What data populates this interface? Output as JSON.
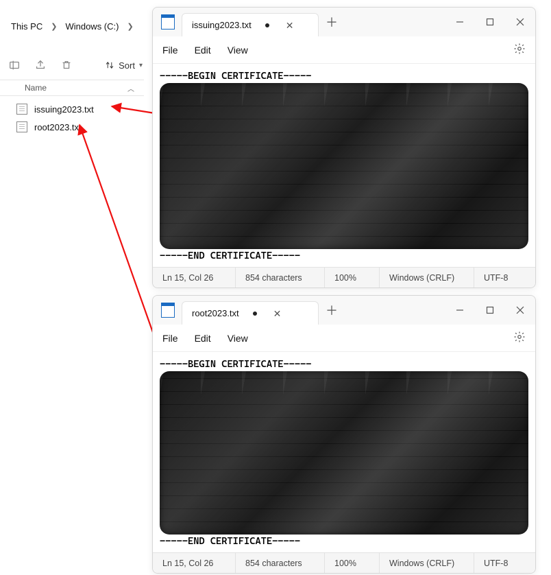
{
  "explorer": {
    "breadcrumbs": [
      "This PC",
      "Windows (C:)"
    ],
    "sort_label": "Sort",
    "col_name": "Name",
    "files": [
      {
        "name": "issuing2023.txt"
      },
      {
        "name": "root2023.txt"
      }
    ]
  },
  "notepad1": {
    "tab": "issuing2023.txt",
    "menus": {
      "file": "File",
      "edit": "Edit",
      "view": "View"
    },
    "begin": "-----BEGIN CERTIFICATE-----",
    "end": "-----END CERTIFICATE-----",
    "status": {
      "pos": "Ln 15, Col 26",
      "chars": "854 characters",
      "zoom": "100%",
      "eol": "Windows (CRLF)",
      "enc": "UTF-8"
    }
  },
  "notepad2": {
    "tab": "root2023.txt",
    "menus": {
      "file": "File",
      "edit": "Edit",
      "view": "View"
    },
    "begin": "-----BEGIN CERTIFICATE-----",
    "end": "-----END CERTIFICATE-----",
    "status": {
      "pos": "Ln 15, Col 26",
      "chars": "854 characters",
      "zoom": "100%",
      "eol": "Windows (CRLF)",
      "enc": "UTF-8"
    }
  }
}
